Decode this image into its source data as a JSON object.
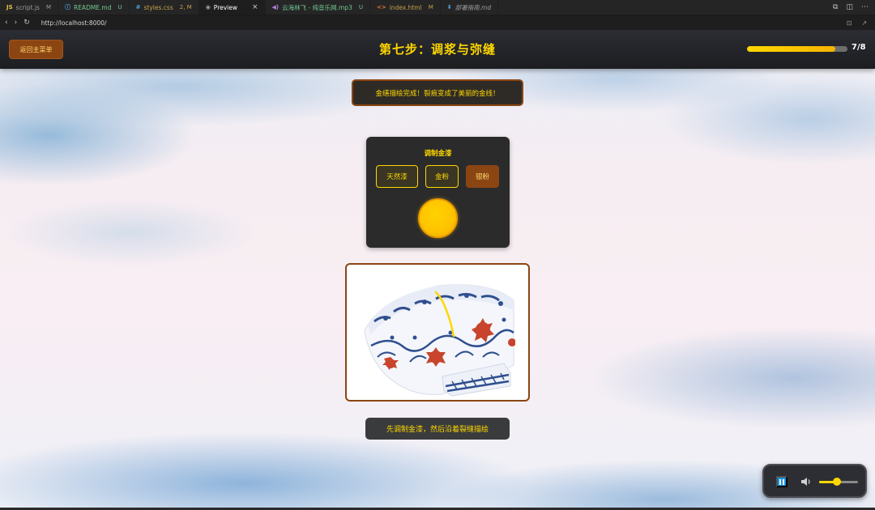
{
  "editor": {
    "tabs": [
      {
        "icon": "JS",
        "label": "script.js",
        "mark": "M",
        "icon_color": "#e8c84a",
        "label_color": "#9d9d9d"
      },
      {
        "icon": "ⓘ",
        "label": "README.md",
        "mark": "U",
        "icon_color": "#4fa3e0",
        "label_color": "#73c991"
      },
      {
        "icon": "#",
        "label": "styles.css",
        "mark": "2, M",
        "icon_color": "#4fa3e0",
        "label_color": "#c5a14a"
      },
      {
        "icon": "◉",
        "label": "Preview",
        "mark": "",
        "icon_color": "#9d9d9d",
        "label_color": "#ffffff"
      },
      {
        "icon": "◀)",
        "label": "云海林飞 - 纯音乐网.mp3",
        "mark": "U",
        "icon_color": "#b07fd6",
        "label_color": "#73c991"
      },
      {
        "icon": "<>",
        "label": "index.html",
        "mark": "M",
        "icon_color": "#e37933",
        "label_color": "#c5a14a"
      },
      {
        "icon": "⬇",
        "label": "部署指南.md",
        "mark": "",
        "icon_color": "#4fa3e0",
        "label_color": "#9d9d9d"
      }
    ],
    "url": "http://localhost:8000/"
  },
  "header": {
    "back_label": "返回主菜单",
    "title": "第七步：调浆与弥缝",
    "progress_text": "7/8",
    "progress_fraction": 0.875
  },
  "status_message": "金缮描绘完成！裂痕变成了美丽的金线！",
  "lacquer": {
    "title": "调制金漆",
    "ingredients": [
      "天然漆",
      "金粉",
      "银粉"
    ],
    "mix_color": "#ffc400"
  },
  "hint": "先调制金漆，然后沿着裂缝描绘",
  "music": {
    "volume_fraction": 0.45,
    "accent": "#ffd700"
  },
  "colors": {
    "gold": "#ffd700",
    "brown": "#8b4513"
  }
}
